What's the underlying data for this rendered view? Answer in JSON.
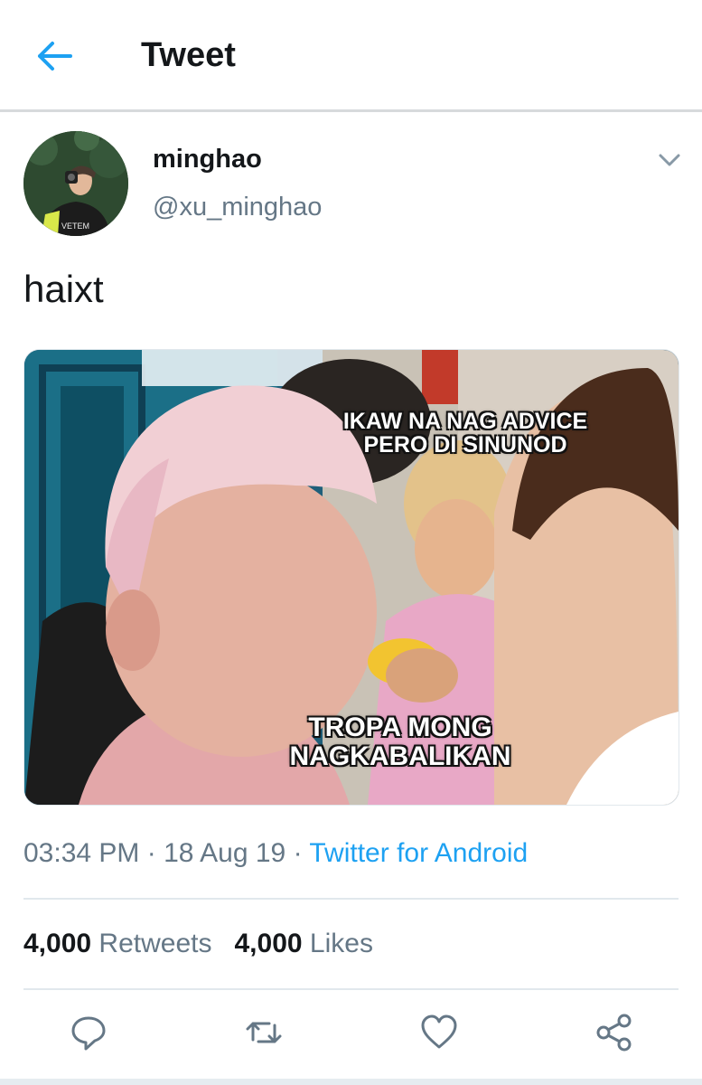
{
  "header": {
    "title": "Tweet",
    "back_icon": "arrow-left-icon"
  },
  "tweet": {
    "author": {
      "name": "minghao",
      "handle": "@xu_minghao"
    },
    "text": "haixt",
    "media": {
      "caption_top": "IKAW NA NAG ADVICE\nPERO DI SINUNOD",
      "caption_bottom": "TROPA MONG\nNAGKABALIKAN"
    },
    "time": "03:34 PM",
    "date": "18 Aug 19",
    "separator": "·",
    "source": "Twitter for Android",
    "retweets_count": "4,000",
    "retweets_label": "Retweets",
    "likes_count": "4,000",
    "likes_label": "Likes"
  },
  "actions": [
    "reply-icon",
    "retweet-icon",
    "like-icon",
    "share-icon"
  ],
  "colors": {
    "accent": "#1da1f2",
    "secondary_text": "#657786",
    "primary_text": "#14171a"
  }
}
